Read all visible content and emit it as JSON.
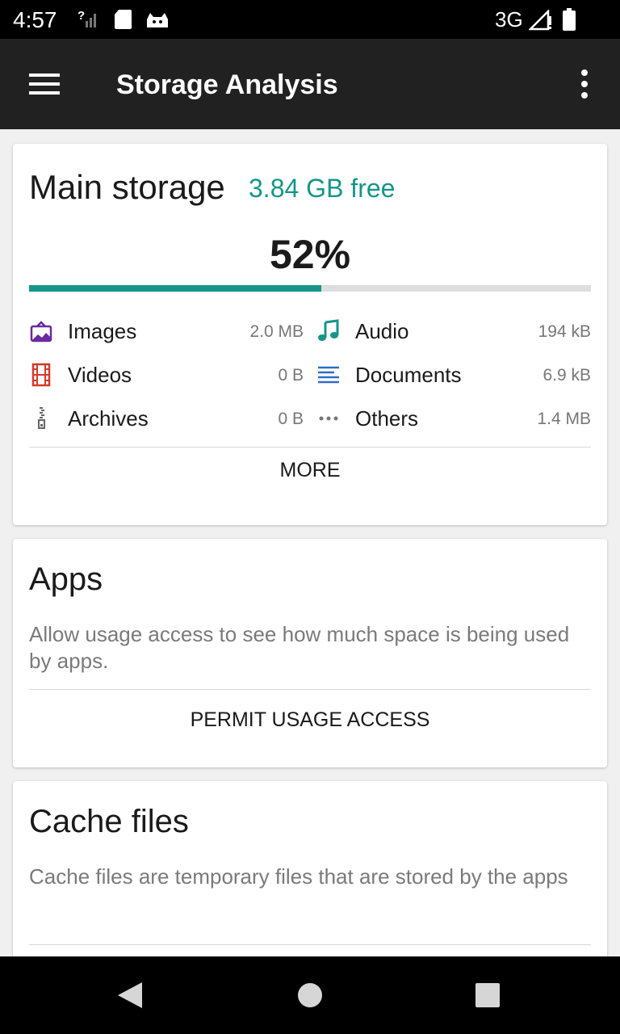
{
  "status_bar": {
    "time": "4:57",
    "network": "3G",
    "icons": [
      "signal-unknown-icon",
      "sd-card-icon",
      "cat-icon",
      "cell-signal-icon",
      "battery-icon"
    ]
  },
  "app_bar": {
    "title": "Storage Analysis",
    "icons": [
      "menu-icon",
      "more-vert-icon"
    ]
  },
  "main_storage": {
    "title": "Main storage",
    "free": "3.84 GB free",
    "percent_label": "52%",
    "used_fraction": 0.52,
    "accent_color": "#159688",
    "categories": [
      {
        "label": "Images",
        "size": "2.0 MB",
        "icon": "image-icon",
        "color": "#6a2aa0"
      },
      {
        "label": "Audio",
        "size": "194 kB",
        "icon": "music-note-icon",
        "color": "#159688"
      },
      {
        "label": "Videos",
        "size": "0 B",
        "icon": "film-icon",
        "color": "#d23a2a"
      },
      {
        "label": "Documents",
        "size": "6.9 kB",
        "icon": "document-lines-icon",
        "color": "#2f6dcb"
      },
      {
        "label": "Archives",
        "size": "0 B",
        "icon": "archive-zip-icon",
        "color": "#666666"
      },
      {
        "label": "Others",
        "size": "1.4 MB",
        "icon": "more-horiz-icon",
        "color": "#777777"
      }
    ],
    "button_label": "MORE"
  },
  "apps": {
    "title": "Apps",
    "description": "Allow usage access to see how much space is being used by apps.",
    "button_label": "PERMIT USAGE ACCESS"
  },
  "cache": {
    "title": "Cache files",
    "description": "Cache files are temporary files that are stored by the apps"
  },
  "nav_bar": {
    "icons": [
      "back-icon",
      "home-icon",
      "recents-icon"
    ]
  }
}
